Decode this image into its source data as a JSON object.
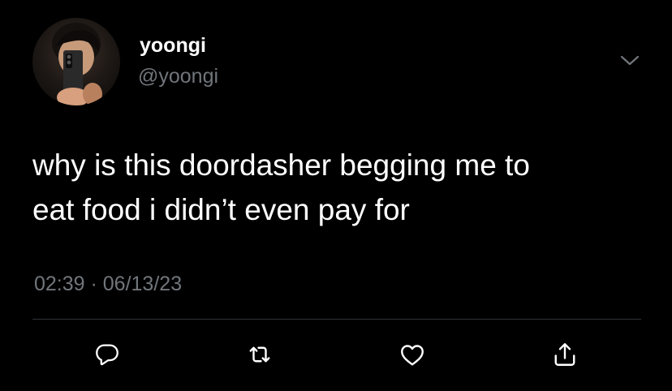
{
  "user": {
    "display_name": "yoongi",
    "handle": "@yoongi"
  },
  "tweet": {
    "text": "why is this doordasher begging me to\neat food i didn’t even pay for",
    "timestamp": "02:39 · 06/13/23"
  },
  "icons": {
    "menu": "chevron-down-icon",
    "reply": "reply-icon",
    "retweet": "retweet-icon",
    "like": "heart-icon",
    "share": "share-icon"
  },
  "colors": {
    "background": "#000000",
    "primary_text": "#ffffff",
    "secondary_text": "#71767b",
    "divider": "#2f3336"
  }
}
